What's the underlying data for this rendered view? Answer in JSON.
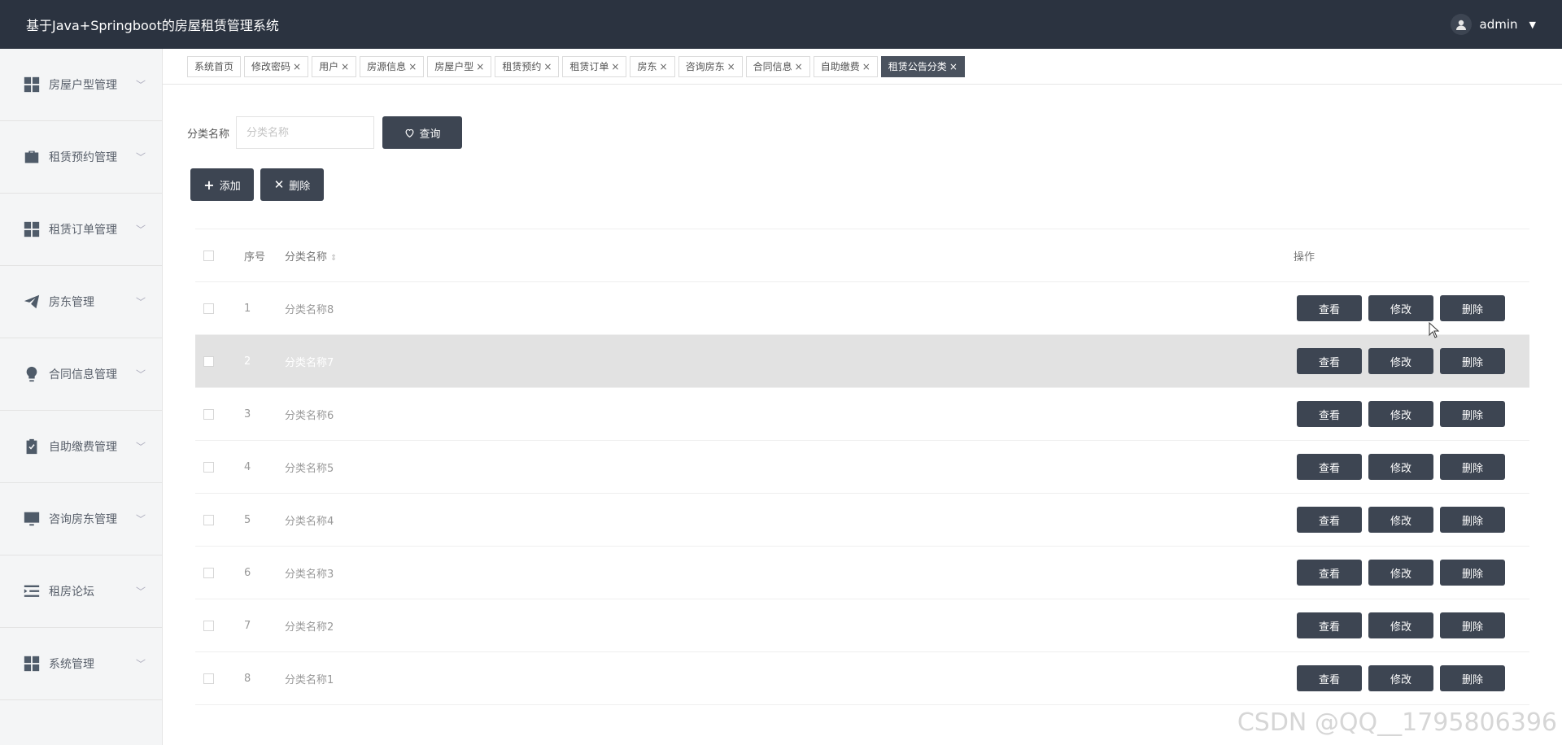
{
  "header": {
    "title": "基于Java+Springboot的房屋租赁管理系统",
    "user": "admin"
  },
  "sidebar": {
    "items": [
      {
        "label": "房屋户型管理",
        "icon": "grid-icon"
      },
      {
        "label": "租赁预约管理",
        "icon": "briefcase-icon"
      },
      {
        "label": "租赁订单管理",
        "icon": "grid-icon"
      },
      {
        "label": "房东管理",
        "icon": "paper-plane-icon"
      },
      {
        "label": "合同信息管理",
        "icon": "lightbulb-icon"
      },
      {
        "label": "自助缴费管理",
        "icon": "clipboard-check-icon"
      },
      {
        "label": "咨询房东管理",
        "icon": "monitor-icon"
      },
      {
        "label": "租房论坛",
        "icon": "list-indent-icon"
      },
      {
        "label": "系统管理",
        "icon": "grid-icon"
      }
    ]
  },
  "tabs": [
    {
      "label": "系统首页",
      "closable": false
    },
    {
      "label": "修改密码",
      "closable": true
    },
    {
      "label": "用户",
      "closable": true
    },
    {
      "label": "房源信息",
      "closable": true
    },
    {
      "label": "房屋户型",
      "closable": true
    },
    {
      "label": "租赁预约",
      "closable": true
    },
    {
      "label": "租赁订单",
      "closable": true
    },
    {
      "label": "房东",
      "closable": true
    },
    {
      "label": "咨询房东",
      "closable": true
    },
    {
      "label": "合同信息",
      "closable": true
    },
    {
      "label": "自助缴费",
      "closable": true
    },
    {
      "label": "租赁公告分类",
      "closable": true,
      "active": true
    }
  ],
  "tab_close_glyph": "×",
  "search": {
    "label": "分类名称",
    "placeholder": "分类名称",
    "button": "查询"
  },
  "actions": {
    "add": "添加",
    "delete": "删除"
  },
  "table": {
    "headers": {
      "index": "序号",
      "name": "分类名称",
      "ops": "操作"
    },
    "rows": [
      {
        "index": "1",
        "name": "分类名称8"
      },
      {
        "index": "2",
        "name": "分类名称7",
        "highlighted": true
      },
      {
        "index": "3",
        "name": "分类名称6"
      },
      {
        "index": "4",
        "name": "分类名称5"
      },
      {
        "index": "5",
        "name": "分类名称4"
      },
      {
        "index": "6",
        "name": "分类名称3"
      },
      {
        "index": "7",
        "name": "分类名称2"
      },
      {
        "index": "8",
        "name": "分类名称1"
      }
    ],
    "row_buttons": {
      "view": "查看",
      "edit": "修改",
      "delete": "删除"
    }
  },
  "watermark": "CSDN @QQ__1795806396",
  "colors": {
    "header_bg": "#2b3340",
    "button_bg": "#3d4552",
    "active_tab_bg": "#4a525e",
    "highlight_row": "#e2e2e2"
  }
}
